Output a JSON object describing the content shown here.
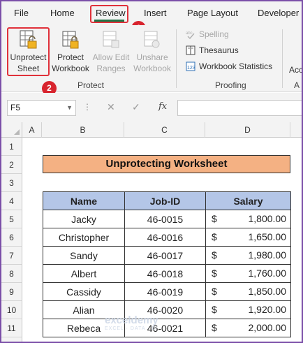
{
  "menu": {
    "tabs": [
      "File",
      "Home",
      "Review",
      "Insert",
      "Page Layout",
      "Developer"
    ],
    "badge_review": "1",
    "badge_unprotect": "2"
  },
  "ribbon": {
    "protect": {
      "unprotect_sheet": [
        "Unprotect",
        "Sheet"
      ],
      "protect_workbook": [
        "Protect",
        "Workbook"
      ],
      "allow_edit_ranges": [
        "Allow Edit",
        "Ranges"
      ],
      "unshare_workbook": [
        "Unshare",
        "Workbook"
      ],
      "group_label": "Protect"
    },
    "proofing": {
      "spelling": "Spelling",
      "thesaurus": "Thesaurus",
      "workbook_statistics": "Workbook Statistics",
      "group_label": "Proofing"
    },
    "accessibility": {
      "label_cut": "Acc",
      "group_label_cut": "A"
    }
  },
  "formula_bar": {
    "name_box": "F5",
    "fx_label": "fx",
    "formula": ""
  },
  "sheet": {
    "columns": [
      "A",
      "B",
      "C",
      "D"
    ],
    "rows": [
      "1",
      "2",
      "3",
      "4",
      "5",
      "6",
      "7",
      "8",
      "9",
      "10",
      "11"
    ],
    "title": "Unprotecting Worksheet",
    "headers": [
      "Name",
      "Job-ID",
      "Salary"
    ],
    "currency": "$",
    "records": [
      {
        "name": "Jacky",
        "job_id": "46-0015",
        "salary": "1,800.00"
      },
      {
        "name": "Christopher",
        "job_id": "46-0016",
        "salary": "1,650.00"
      },
      {
        "name": "Sandy",
        "job_id": "46-0017",
        "salary": "1,980.00"
      },
      {
        "name": "Albert",
        "job_id": "46-0018",
        "salary": "1,760.00"
      },
      {
        "name": "Cassidy",
        "job_id": "46-0019",
        "salary": "1,850.00"
      },
      {
        "name": "Alian",
        "job_id": "46-0020",
        "salary": "1,920.00"
      },
      {
        "name": "Rebeca",
        "job_id": "46-0021",
        "salary": "2,000.00"
      }
    ]
  },
  "watermark": {
    "brand": "exceldemy",
    "tagline": "EXCEL · DATA · BI"
  },
  "colors": {
    "accent_green": "#217346",
    "highlight_red": "#e0313a",
    "title_fill": "#f4b183",
    "header_fill": "#b4c6e7"
  }
}
